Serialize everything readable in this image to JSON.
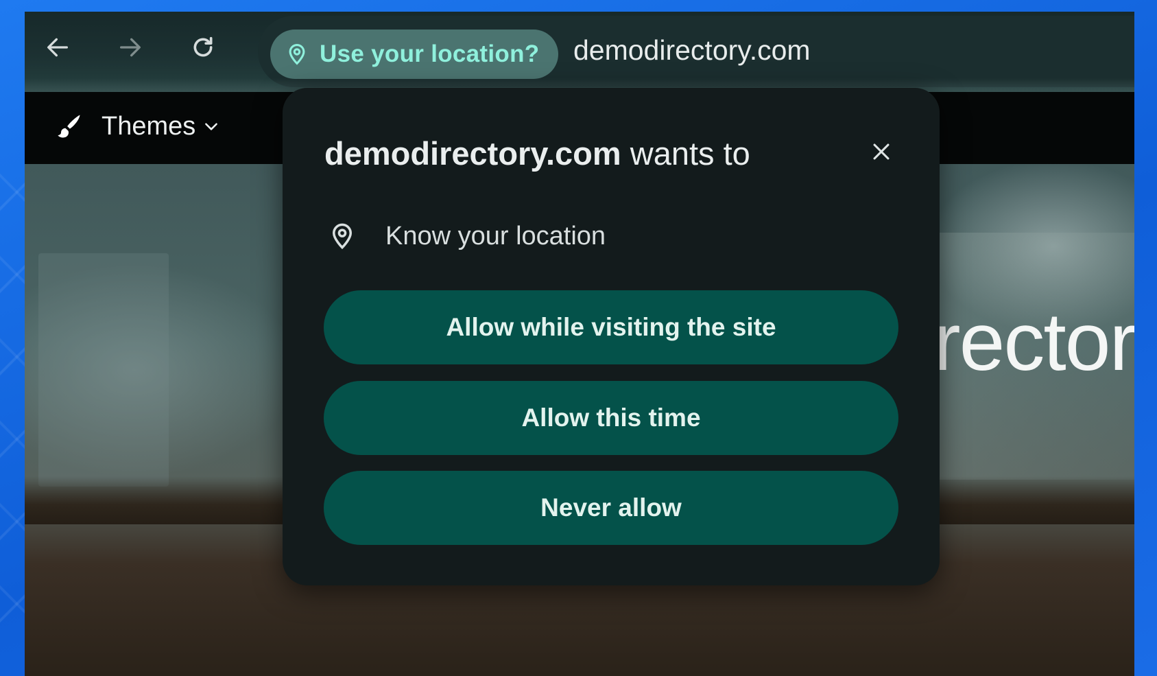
{
  "toolbar": {
    "back_icon": "arrow-left-icon",
    "forward_icon": "arrow-right-icon",
    "reload_icon": "reload-icon",
    "location_chip_label": "Use your location?",
    "url": "demodirectory.com",
    "accent_color": "#8ff0dc"
  },
  "bookmarks": {
    "themes_label": "Themes"
  },
  "page": {
    "hero_text": "irector"
  },
  "permission_prompt": {
    "title_domain": "demodirectory.com",
    "title_suffix": " wants to",
    "permission_label": "Know your location",
    "buttons": {
      "allow_while_visiting": "Allow while visiting the site",
      "allow_this_time": "Allow this time",
      "never_allow": "Never allow"
    },
    "button_color": "#04524a",
    "background_color": "#131b1c"
  }
}
